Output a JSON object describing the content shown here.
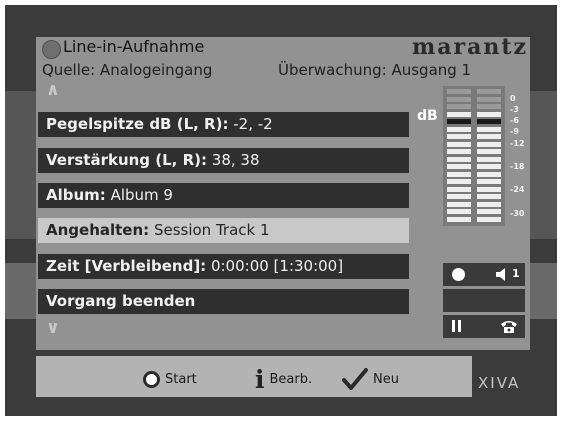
{
  "header": {
    "title": "Line-in-Aufnahme",
    "brand": "marantz",
    "source": "Quelle: Analogeingang",
    "monitoring": "Überwachung: Ausgang 1"
  },
  "menu": {
    "items": [
      {
        "key": "Pegelspitze dB (L, R):",
        "value": " -2, -2",
        "selected": false
      },
      {
        "key": "Verstärkung (L, R):",
        "value": " 38, 38",
        "selected": false
      },
      {
        "key": "Album:",
        "value": " Album 9",
        "selected": false
      },
      {
        "key": "Angehalten:",
        "value": " Session Track 1",
        "selected": true
      },
      {
        "key": "Zeit [Verbleibend]:",
        "value": " 0:00:00 [1:30:00]",
        "selected": false
      },
      {
        "key": "Vorgang beenden",
        "value": "",
        "selected": false
      }
    ],
    "scroll_up": "∧",
    "scroll_down": "∨"
  },
  "meter": {
    "unit": "dB",
    "scale": [
      "0",
      "-3",
      "-6",
      "-9",
      "-12",
      "-18",
      "-24",
      "-30"
    ],
    "level_left": 0.85,
    "level_right": 0.85
  },
  "status": {
    "volume_badge": "1"
  },
  "footer": {
    "start_label": "Start",
    "edit_label": "Bearb.",
    "new_label": "Neu",
    "logo": "XIVA"
  },
  "colors": {
    "frame": "#3b3b3b",
    "panel": "#929292",
    "menu_item": "#2f2f2f",
    "menu_selected": "#c8c8c8"
  }
}
